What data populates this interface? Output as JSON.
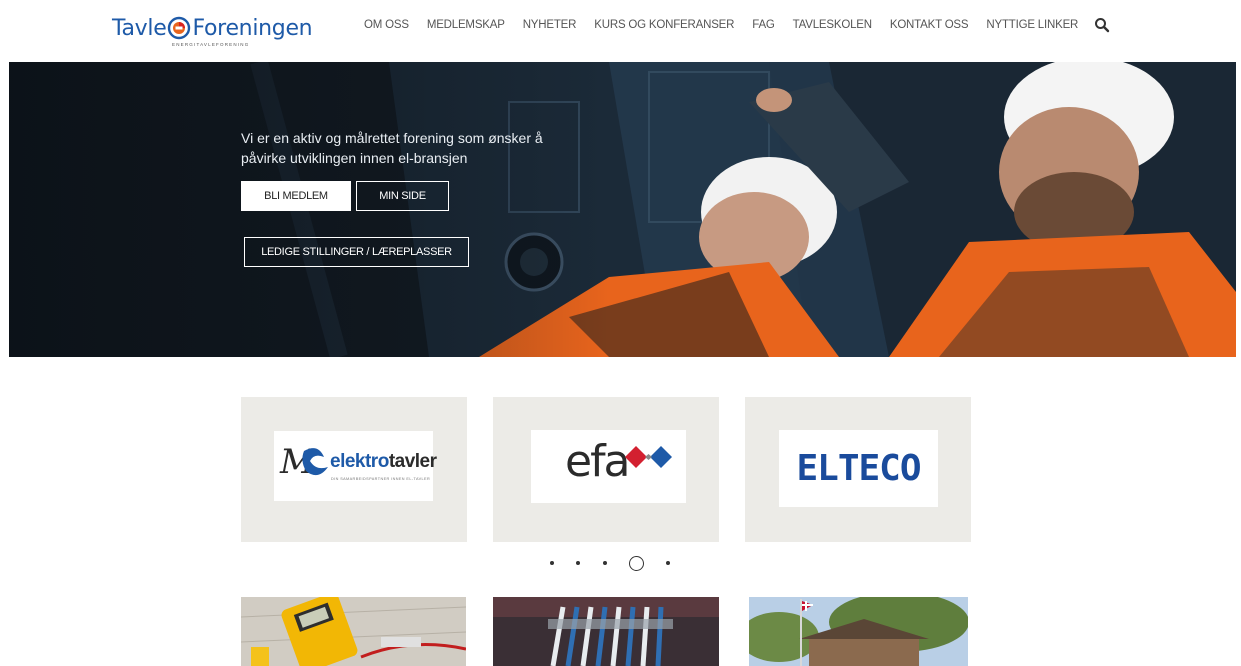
{
  "header": {
    "logo": {
      "part1": "Tavle",
      "part2": "Foreningen",
      "tagline": "ENERGITAVLEFORENING"
    },
    "nav": [
      {
        "label": "OM OSS"
      },
      {
        "label": "MEDLEMSKAP"
      },
      {
        "label": "NYHETER"
      },
      {
        "label": "KURS OG KONFERANSER"
      },
      {
        "label": "FAG"
      },
      {
        "label": "TAVLESKOLEN"
      },
      {
        "label": "KONTAKT OSS"
      },
      {
        "label": "NYTTIGE LINKER"
      }
    ],
    "search_icon": "search-icon"
  },
  "hero": {
    "text": "Vi er en aktiv og målrettet forening som ønsker å påvirke utviklingen innen el-bransjen",
    "buttons": {
      "join": "BLI MEDLEM",
      "my_page": "MIN SIDE",
      "jobs": "LEDIGE STILLINGER / LÆREPLASSER"
    }
  },
  "partners": [
    {
      "name": "MCS elektrotavler",
      "brand": "elektro",
      "brand2": "tavler",
      "tagline": "DIN SAMARBEIDSPARTNER INNEN EL-TAVLER"
    },
    {
      "name": "efa",
      "brand": "efa"
    },
    {
      "name": "ELTECO",
      "brand": "ELTECO"
    }
  ],
  "carousel": {
    "slides": 5,
    "active_slide": 4
  },
  "colors": {
    "logo_blue": "#1e5aa8",
    "logo_red": "#d9231f",
    "accent_orange": "#e8641c",
    "efa_red": "#d32030",
    "efa_blue": "#1e5aa8",
    "elteco_blue": "#1a4b9c"
  }
}
